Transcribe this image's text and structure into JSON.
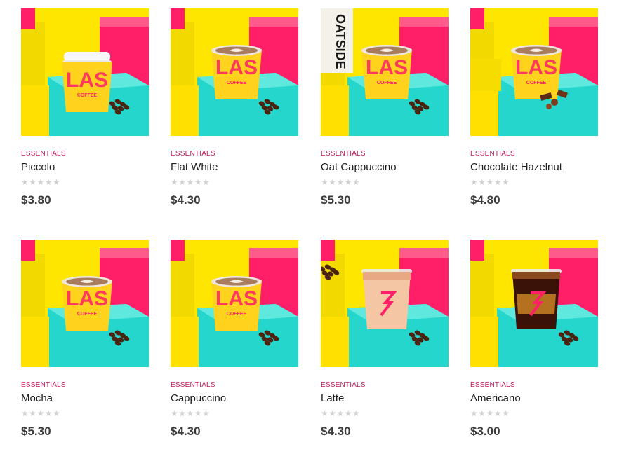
{
  "colors": {
    "accent": "#c2185b",
    "bg_yellow": "#ffe600",
    "pink": "#ff1f68",
    "teal": "#24d6cc",
    "cup_yellow": "#ffd21e"
  },
  "products": [
    {
      "category": "ESSENTIALS",
      "name": "Piccolo",
      "price": "$3.80",
      "rating": 0,
      "image": "piccolo-cup-lid-icon"
    },
    {
      "category": "ESSENTIALS",
      "name": "Flat White",
      "price": "$4.30",
      "rating": 0,
      "image": "flat-white-cup-icon"
    },
    {
      "category": "ESSENTIALS",
      "name": "Oat Cappuccino",
      "price": "$5.30",
      "rating": 0,
      "image": "oat-cappuccino-cup-icon",
      "carton_text": "OATSIDE"
    },
    {
      "category": "ESSENTIALS",
      "name": "Chocolate Hazelnut",
      "price": "$4.80",
      "rating": 0,
      "image": "chocolate-hazelnut-cup-icon"
    },
    {
      "category": "ESSENTIALS",
      "name": "Mocha",
      "price": "$5.30",
      "rating": 0,
      "image": "mocha-cup-icon"
    },
    {
      "category": "ESSENTIALS",
      "name": "Cappuccino",
      "price": "$4.30",
      "rating": 0,
      "image": "cappuccino-cup-icon"
    },
    {
      "category": "ESSENTIALS",
      "name": "Latte",
      "price": "$4.30",
      "rating": 0,
      "image": "iced-latte-cup-icon"
    },
    {
      "category": "ESSENTIALS",
      "name": "Americano",
      "price": "$3.00",
      "rating": 0,
      "image": "iced-americano-cup-icon"
    }
  ],
  "cup_brand": {
    "letters": "LAS",
    "word": "COFFEE"
  },
  "rating_glyphs": "★★★★★"
}
